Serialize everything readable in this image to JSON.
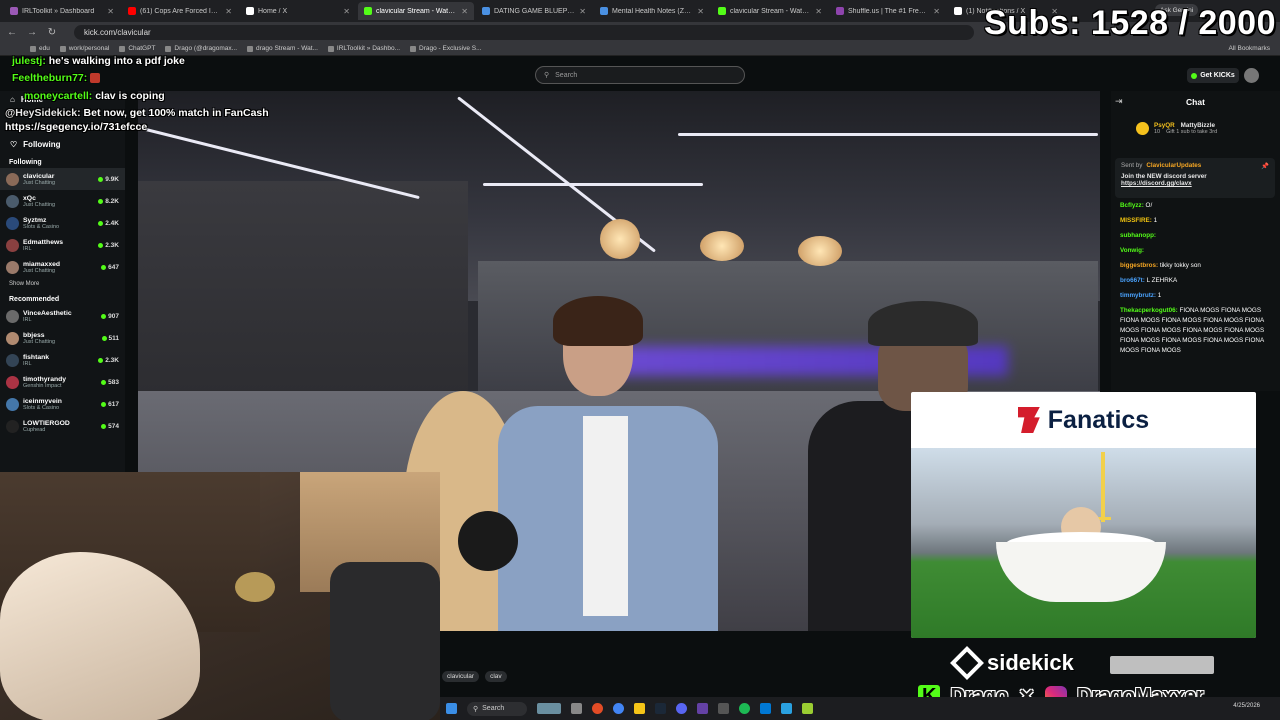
{
  "browser": {
    "tabs": [
      {
        "title": "IRLToolkit » Dashboard",
        "color": "#9b59b6"
      },
      {
        "title": "(61) Cops Are Forced Into a Sp",
        "color": "#ff0000"
      },
      {
        "title": "Home / X",
        "color": "#ffffff"
      },
      {
        "title": "clavicular Stream - Watch L",
        "color": "#53fc18"
      },
      {
        "title": "DATING GAME BLUEPRINT (Be",
        "color": "#4a90e2"
      },
      {
        "title": "Mental Health Notes (Zherka",
        "color": "#4a90e2"
      },
      {
        "title": "clavicular Stream - Watch Live",
        "color": "#53fc18"
      },
      {
        "title": "Shuffle.us | The #1 Free to Play",
        "color": "#8e44ad"
      },
      {
        "title": "(1) Notifications / X",
        "color": "#ffffff"
      }
    ],
    "url": "kick.com/clavicular",
    "ask_gemini": "Ask Gemini",
    "bookmarks": [
      "edu",
      "work/personal",
      "ChatGPT",
      "Drago (@dragomax...",
      "drago Stream - Wat...",
      "IRLToolkit » Dashbo...",
      "Drago - Exclusive S..."
    ],
    "all_bookmarks": "All Bookmarks"
  },
  "overlay": {
    "subs": "Subs: 1528 / 2000",
    "lines": [
      {
        "user": "julestj:",
        "text": "he's walking into a pdf joke"
      },
      {
        "user": "Feeltheburn77:",
        "text": ""
      },
      {
        "user": "moneycartell:",
        "text": "clav is coping"
      },
      {
        "user": "@HeySidekick:",
        "text": "Bet now, get 100% match in FanCash"
      },
      {
        "user": "",
        "text": "https://sgegency.io/731efcce"
      }
    ]
  },
  "kick": {
    "search_placeholder": "Search",
    "get_kicks": "Get KICKs"
  },
  "sidebar": {
    "home": "Home",
    "following_label": "Following",
    "following_section": "Following",
    "following": [
      {
        "name": "clavicular",
        "cat": "Just Chatting",
        "count": "9.9K",
        "color": "#8a6a58"
      },
      {
        "name": "xQc",
        "cat": "Just Chatting",
        "count": "8.2K",
        "color": "#4a5b6c"
      },
      {
        "name": "Syztmz",
        "cat": "Slots & Casino",
        "count": "2.4K",
        "color": "#2a4a7a"
      },
      {
        "name": "Edmatthews",
        "cat": "IRL",
        "count": "2.3K",
        "color": "#8a4040"
      },
      {
        "name": "miamaxxed",
        "cat": "Just Chatting",
        "count": "647",
        "color": "#9a7a6a"
      }
    ],
    "show_more": "Show More",
    "recommended_section": "Recommended",
    "recommended": [
      {
        "name": "VinceAesthetic",
        "cat": "IRL",
        "count": "907",
        "color": "#6a6a6a"
      },
      {
        "name": "bbjess",
        "cat": "Just Chatting",
        "count": "511",
        "color": "#b08a70"
      },
      {
        "name": "fishtank",
        "cat": "IRL",
        "count": "2.3K",
        "color": "#334455"
      },
      {
        "name": "timothyrandy",
        "cat": "Genshin Impact",
        "count": "583",
        "color": "#aa3344"
      },
      {
        "name": "iceinmyvein",
        "cat": "Slots & Casino",
        "count": "617",
        "color": "#4477aa"
      },
      {
        "name": "LOWTIERGOD",
        "cat": "Cuphead",
        "count": "574",
        "color": "#222222"
      }
    ]
  },
  "chat": {
    "title": "Chat",
    "gifter_name": "PsyQR",
    "gifter_count": "10",
    "gifter_target": "MattyBizzle",
    "gifter_note": "Gift 1 sub to take 3rd",
    "pinned_by": "Sent by",
    "pinned_user": "ClavicularUpdates",
    "pinned_text": "Join the NEW discord server",
    "pinned_link": "https://discord.gg/clavx",
    "messages": [
      {
        "user": "Bcflyzz:",
        "text": "O/",
        "color": "#53fc18"
      },
      {
        "user": "MISSFIRE:",
        "text": "1",
        "color": "#f1c40f"
      },
      {
        "user": "subhanopp:",
        "text": "",
        "color": "#53fc18"
      },
      {
        "user": "Vonwig:",
        "text": "",
        "color": "#53fc18"
      },
      {
        "user": "biggestbros:",
        "text": "tikky tokky son",
        "color": "#f5a623"
      },
      {
        "user": "bro667t:",
        "text": "L ZEHRKA",
        "color": "#4aa3ff"
      },
      {
        "user": "timmybrutz:",
        "text": "1",
        "color": "#4aa3ff"
      },
      {
        "user": "Thekacperkogut06:",
        "text": "FIONA MOGS FIONA MOGS FIONA MOGS FIONA MOGS FIONA MOGS FIONA MOGS FIONA MOGS FIONA MOGS FIONA MOGS FIONA MOGS FIONA MOGS FIONA MOGS FIONA MOGS FIONA MOGS",
        "color": "#53fc18"
      }
    ]
  },
  "ad": {
    "brand": "Fanatics",
    "sponsor": "sidekick",
    "streamer": "Drago",
    "instagram": "DragoMaxxer"
  },
  "tags": [
    "clavicular",
    "clav"
  ],
  "taskbar": {
    "search": "Search",
    "date": "4/25/2026"
  }
}
